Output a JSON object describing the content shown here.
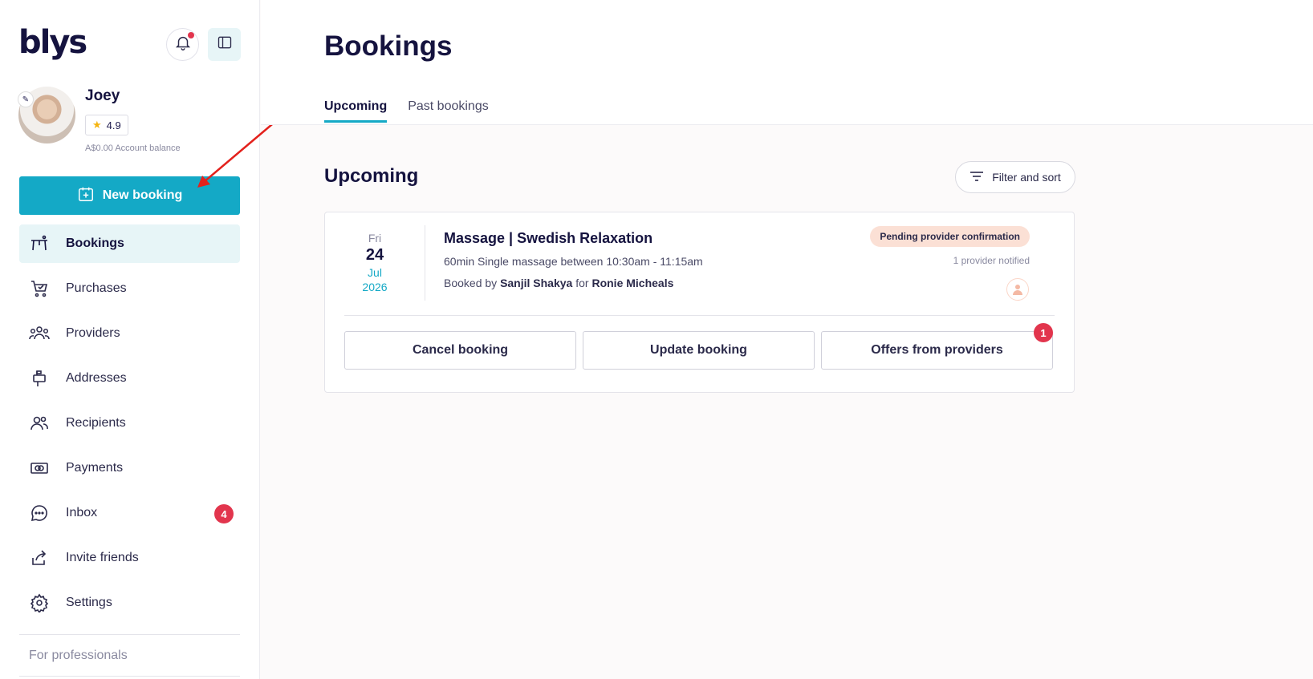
{
  "brand": {
    "logo_text": "blys"
  },
  "header_icons": {
    "bell": "bell-icon",
    "panel": "sidebar-toggle-icon"
  },
  "user": {
    "name": "Joey",
    "rating": "4.9",
    "balance_amount": "A$0.00",
    "balance_label": "Account balance"
  },
  "sidebar": {
    "new_booking_label": "New booking",
    "items": [
      {
        "label": "Bookings",
        "icon": "massage-table-icon",
        "active": true
      },
      {
        "label": "Purchases",
        "icon": "cart-icon"
      },
      {
        "label": "Providers",
        "icon": "people-group-icon"
      },
      {
        "label": "Addresses",
        "icon": "mailbox-icon"
      },
      {
        "label": "Recipients",
        "icon": "users-icon"
      },
      {
        "label": "Payments",
        "icon": "money-icon"
      },
      {
        "label": "Inbox",
        "icon": "chat-icon",
        "badge": "4"
      },
      {
        "label": "Invite friends",
        "icon": "share-icon"
      },
      {
        "label": "Settings",
        "icon": "gear-icon"
      }
    ],
    "for_professionals": "For professionals"
  },
  "main": {
    "title": "Bookings",
    "tabs": [
      {
        "label": "Upcoming",
        "active": true
      },
      {
        "label": "Past bookings"
      }
    ],
    "section_title": "Upcoming",
    "filter_label": "Filter and sort"
  },
  "booking": {
    "day": "Fri",
    "date": "24",
    "month": "Jul",
    "year": "2026",
    "title": "Massage | Swedish Relaxation",
    "detail": "60min Single massage between 10:30am - 11:15am",
    "booked_by_prefix": "Booked by",
    "booked_by_name": "Sanjil Shakya",
    "for_word": "for",
    "recipient": "Ronie Micheals",
    "status": "Pending provider confirmation",
    "notified": "1 provider notified",
    "actions": {
      "cancel": "Cancel booking",
      "update": "Update booking",
      "offers": "Offers from providers",
      "offers_badge": "1"
    }
  },
  "colors": {
    "brand_teal": "#14a9c6",
    "navy": "#15133f",
    "badge_red": "#e2354d",
    "pending_bg": "#fbe0d5",
    "active_nav_bg": "#e7f5f7"
  }
}
